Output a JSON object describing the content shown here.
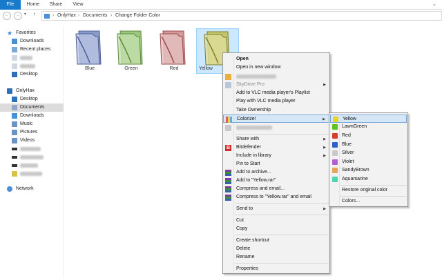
{
  "ribbon": {
    "tabs": [
      "File",
      "Home",
      "Share",
      "View"
    ]
  },
  "address": {
    "crumbs": [
      "OnlyHax",
      "Documents",
      "Change Folder Color"
    ]
  },
  "sidebar": {
    "favorites": "Favorites",
    "fav_items": [
      "Downloads",
      "Recent places",
      "Desktop"
    ],
    "computer": "OnlyHax",
    "pc_items": [
      "Desktop",
      "Documents",
      "Downloads",
      "Music",
      "Pictures",
      "Videos"
    ],
    "network": "Network"
  },
  "folders": [
    {
      "name": "Blue",
      "color": "#6b80b8"
    },
    {
      "name": "Green",
      "color": "#7fb25c"
    },
    {
      "name": "Red",
      "color": "#c46b6b"
    },
    {
      "name": "Yellow",
      "color": "#a7ad3c"
    }
  ],
  "context_menu": {
    "open": "Open",
    "open_new_window": "Open in new window",
    "skydrive": "SkyDrive Pro",
    "vlc_playlist": "Add to VLC media player's Playlist",
    "vlc_play": "Play with VLC media player",
    "ownership": "Take Ownership",
    "colorize": "Colorize!",
    "share_with": "Share with",
    "bitdefender": "Bitdefender",
    "include_library": "Include in library",
    "pin_start": "Pin to Start",
    "add_archive": "Add to archive...",
    "add_rar": "Add to \"Yellow.rar\"",
    "compress_email": "Compress and email...",
    "compress_rar_email": "Compress to \"Yellow.rar\" and email",
    "send_to": "Send to",
    "cut": "Cut",
    "copy": "Copy",
    "create_shortcut": "Create shortcut",
    "delete": "Delete",
    "rename": "Rename",
    "properties": "Properties"
  },
  "colorize_menu": {
    "colors": [
      {
        "label": "Yellow",
        "color": "#e9d41f"
      },
      {
        "label": "LawnGreen",
        "color": "#5cc21f"
      },
      {
        "label": "Red",
        "color": "#d83a2e"
      },
      {
        "label": "Blue",
        "color": "#2f5fc9"
      },
      {
        "label": "Silver",
        "color": "#c9c9c9"
      },
      {
        "label": "Violet",
        "color": "#b05fd8"
      },
      {
        "label": "SandyBrown",
        "color": "#e7a35a"
      },
      {
        "label": "Aquamarine",
        "color": "#4fd4b0"
      }
    ],
    "restore": "Restore original color",
    "colors_more": "Colors..."
  }
}
